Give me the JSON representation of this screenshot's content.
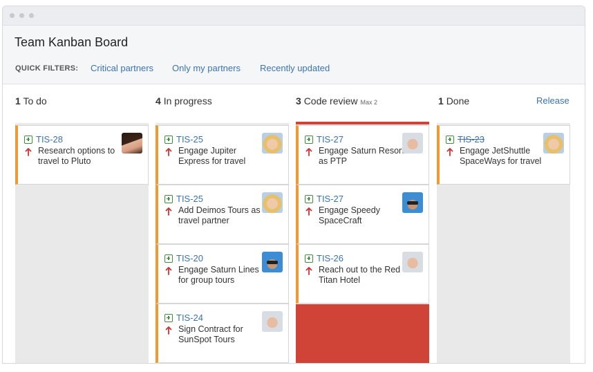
{
  "board": {
    "title": "Team Kanban Board",
    "quick_filters_label": "QUICK FILTERS:",
    "filters": [
      "Critical partners",
      "Only my partners",
      "Recently updated"
    ],
    "release_label": "Release"
  },
  "columns": [
    {
      "count": "1",
      "name": "To do",
      "max": ""
    },
    {
      "count": "4",
      "name": "In progress",
      "max": ""
    },
    {
      "count": "3",
      "name": "Code review",
      "max": "Max 2"
    },
    {
      "count": "1",
      "name": "Done",
      "max": ""
    }
  ],
  "cards": {
    "todo": [
      {
        "key": "TIS-28",
        "summary": "Research options to travel to Pluto",
        "avatar": "woman-avatar"
      }
    ],
    "in_progress": [
      {
        "key": "TIS-25",
        "summary": "Engage Jupiter Express for travel",
        "avatar": "blonde-avatar"
      },
      {
        "key": "TIS-25",
        "summary": "Add Deimos Tours as a travel partner",
        "avatar": "blonde-avatar"
      },
      {
        "key": "TIS-20",
        "summary": "Engage Saturn Lines for group tours",
        "avatar": "sunglasses-avatar"
      },
      {
        "key": "TIS-24",
        "summary": "Sign Contract for SunSpot Tours",
        "avatar": "man-avatar"
      }
    ],
    "code_review": [
      {
        "key": "TIS-27",
        "summary": "Engage Saturn Resort as PTP",
        "avatar": "man-avatar"
      },
      {
        "key": "TIS-27",
        "summary": "Engage Speedy SpaceCraft",
        "avatar": "sunglasses-avatar"
      },
      {
        "key": "TIS-26",
        "summary": "Reach out to the Red Titan Hotel",
        "avatar": "man-avatar"
      }
    ],
    "done": [
      {
        "key": "TIS-23",
        "summary": "Engage JetShuttle SpaceWays for travel",
        "avatar": "blonde-avatar"
      }
    ]
  },
  "colors": {
    "link": "#3b73af",
    "card_accent": "#f09a35",
    "over_limit": "#d04437",
    "priority_arrow": "#cc3333",
    "story_icon": "#3e8e3e"
  }
}
